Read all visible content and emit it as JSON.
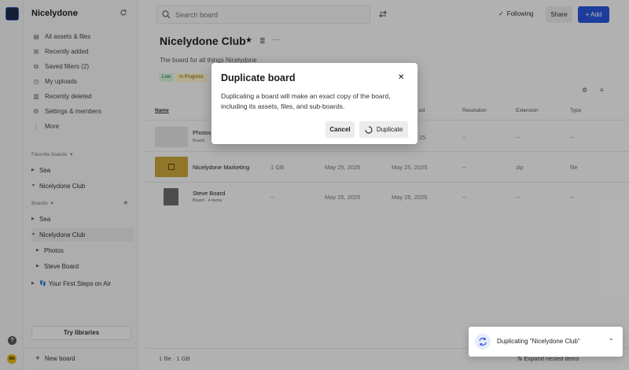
{
  "sidebar": {
    "workspace_name": "Nicelydone",
    "nav": [
      {
        "label": "All assets & files",
        "icon": "assets-icon"
      },
      {
        "label": "Recently added",
        "icon": "plus-square-icon"
      },
      {
        "label": "Saved filters (2)",
        "icon": "filter-icon"
      },
      {
        "label": "My uploads",
        "icon": "clock-icon"
      },
      {
        "label": "Recently deleted",
        "icon": "trash-icon"
      },
      {
        "label": "Settings & members",
        "icon": "gear-icon"
      },
      {
        "label": "More",
        "icon": "more-icon"
      }
    ],
    "favorites_label": "Favorite boards",
    "favorites": [
      "Sea",
      "Nicelydone Club"
    ],
    "boards_label": "Boards",
    "boards": [
      "Sea",
      "Nicelydone Club",
      "Photos",
      "Steve Board",
      "Your First Steps on Air"
    ],
    "try_libraries": "Try libraries",
    "new_board": "New board",
    "avatar_initials": "RR",
    "help": "?"
  },
  "topbar": {
    "search_placeholder": "Search board",
    "following": "Following",
    "share": "Share",
    "add": "Add"
  },
  "board": {
    "title": "Nicelydone Club",
    "description": "The board for all things Nicelydone",
    "tags": [
      {
        "label": "Low",
        "bg": "#d6f2dc",
        "fg": "#2b6a3a"
      },
      {
        "label": "In Progress",
        "bg": "#fbf0c5",
        "fg": "#7a5d00"
      }
    ],
    "columns": [
      "Name",
      "",
      "",
      "ed",
      "Resolution",
      "Extension",
      "Type"
    ],
    "rows": [
      {
        "name": "Photos",
        "sub": "Board",
        "size": "",
        "created": "",
        "modified": "25",
        "resolution": "--",
        "extension": "--",
        "type": "--"
      },
      {
        "name": "Nicelydone Marketing",
        "sub": "",
        "size": "1 GB",
        "created": "May 25, 2025",
        "modified": "May 25, 2025",
        "resolution": "--",
        "extension": "zip",
        "type": "file"
      },
      {
        "name": "Steve Board",
        "sub": "Board · 4 items",
        "size": "--",
        "created": "May 25, 2025",
        "modified": "May 25, 2025",
        "resolution": "--",
        "extension": "--",
        "type": "--"
      }
    ],
    "footer": "1 file · 1 GB",
    "expand": "Expand nested items"
  },
  "modal": {
    "title": "Duplicate board",
    "body": "Duplicating a board will make an exact copy of the board, including its assets, files, and sub-boards.",
    "cancel": "Cancel",
    "duplicate": "Duplicate"
  },
  "toast": {
    "text": "Duplicating \"Nicelydone Club\""
  }
}
